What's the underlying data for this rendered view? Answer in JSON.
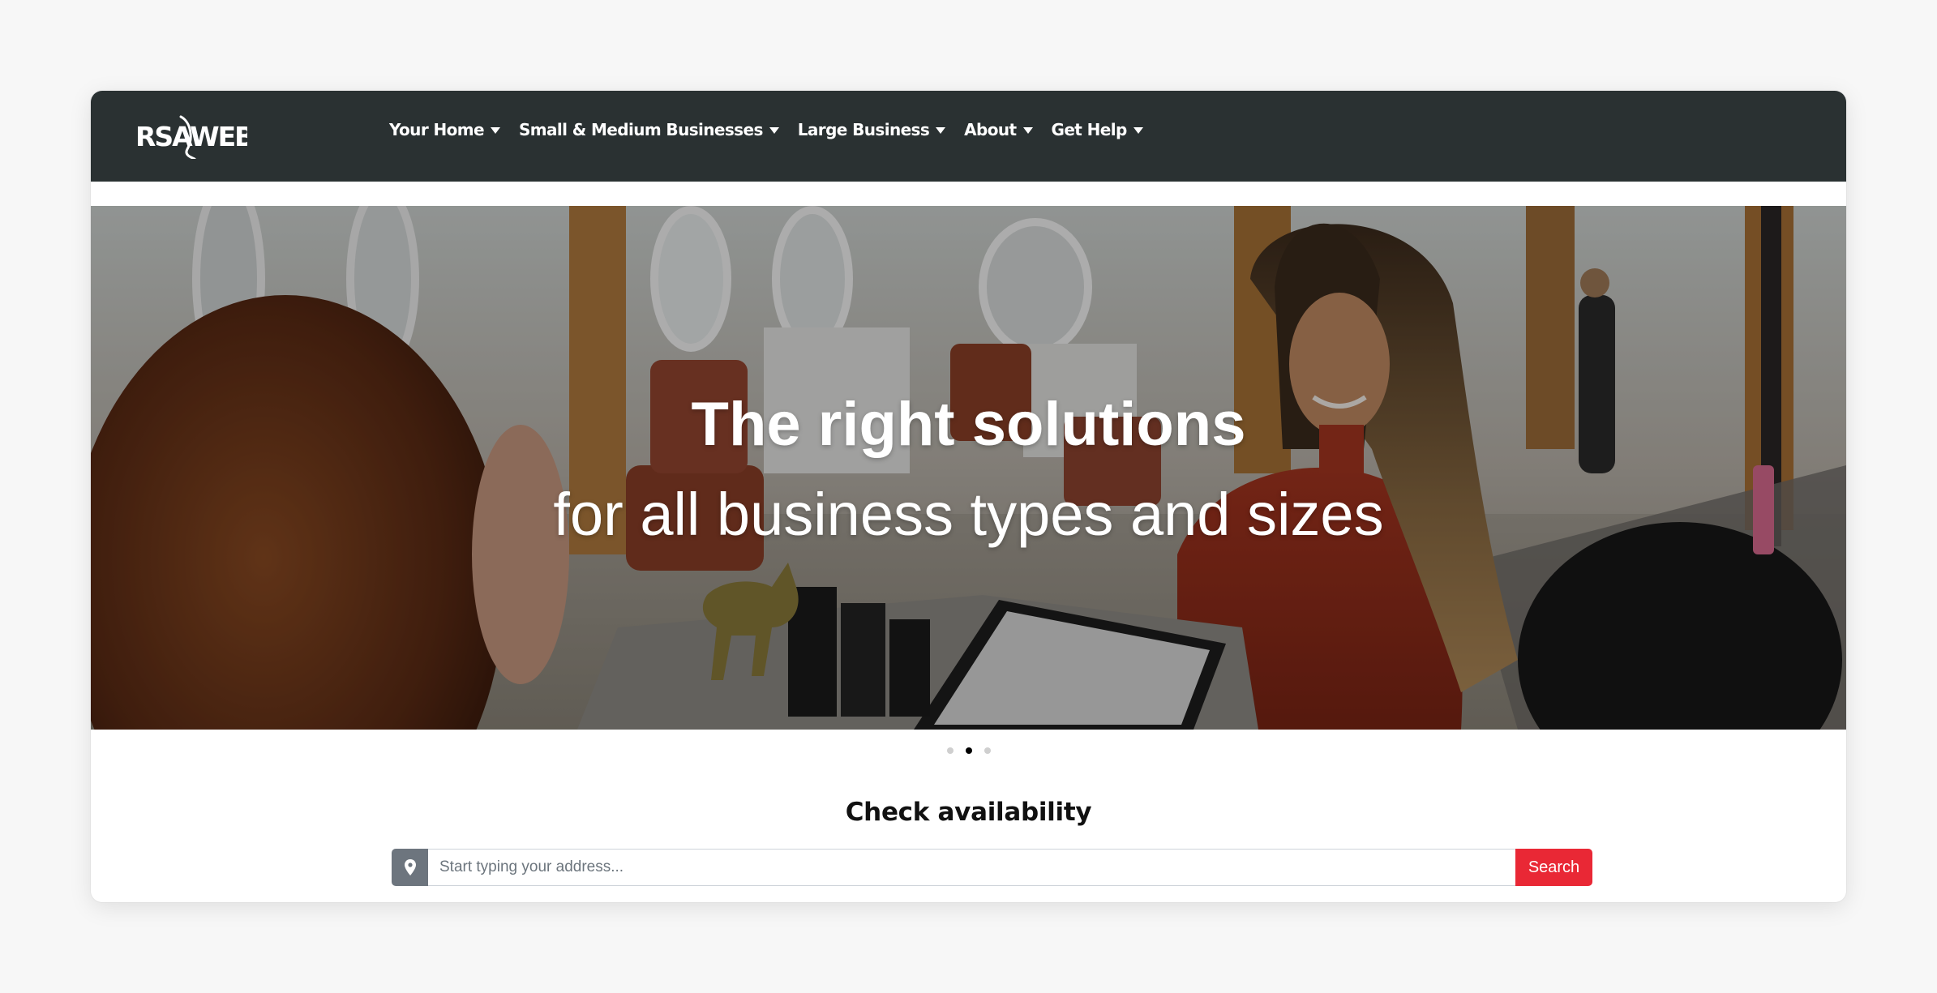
{
  "brand": {
    "logo_text": "RSAWEB",
    "nav_bg": "#2a3132"
  },
  "nav": {
    "items": [
      {
        "label": "Your Home",
        "icon": "caret-down-icon"
      },
      {
        "label": "Small & Medium Businesses",
        "icon": "caret-down-icon"
      },
      {
        "label": "Large Business",
        "icon": "caret-down-icon"
      },
      {
        "label": "About",
        "icon": "caret-down-icon"
      },
      {
        "label": "Get Help",
        "icon": "caret-down-icon"
      }
    ]
  },
  "hero": {
    "title": "The right solutions",
    "subtitle": "for all business types and sizes",
    "image_description": "salon receptionist smiling at customer over laptop"
  },
  "carousel": {
    "slide_count": 3,
    "active_index": 1
  },
  "availability": {
    "title": "Check availability",
    "location_icon": "map-pin-icon",
    "input_value": "",
    "input_placeholder": "Start typing your address...",
    "search_label": "Search",
    "accent_color": "#e92835"
  }
}
